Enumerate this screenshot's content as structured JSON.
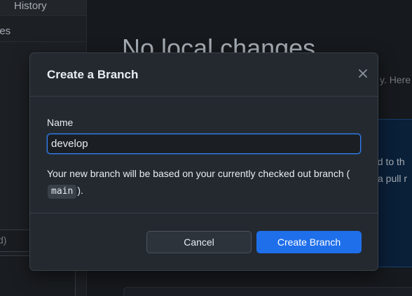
{
  "sidebar": {
    "history_label": "History",
    "files_label": "les",
    "summary_placeholder": "d)"
  },
  "main": {
    "title": "No local changes",
    "subtext": "y. Here",
    "callout_line1": "ed to th",
    "callout_line2": "a pull r"
  },
  "dialog": {
    "title": "Create a Branch",
    "close_icon": "close-icon",
    "name_label": "Name",
    "name_value": "develop",
    "help_prefix": "Your new branch will be based on your currently checked out branch (",
    "help_branch": "main",
    "help_suffix": ").",
    "cancel_label": "Cancel",
    "create_label": "Create Branch"
  },
  "colors": {
    "accent": "#1f6feb",
    "focus_border": "#2f81f7",
    "dialog_bg": "#24292f"
  }
}
